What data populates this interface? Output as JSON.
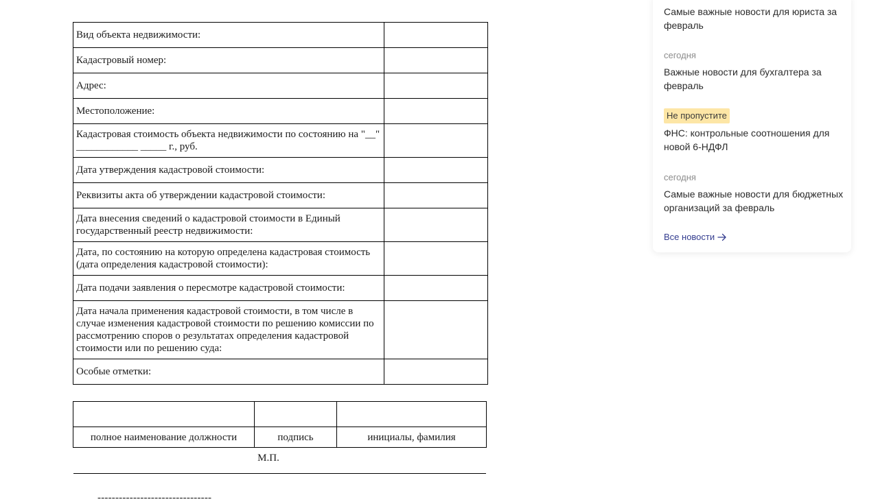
{
  "form": {
    "rows": [
      {
        "label": "Вид объекта недвижимости:"
      },
      {
        "label": "Кадастровый номер:"
      },
      {
        "label": "Адрес:"
      },
      {
        "label": "Местоположение:"
      },
      {
        "label": "Кадастровая стоимость объекта недвижимости по состоянию на \"__\" ____________ _____ г., руб."
      },
      {
        "label": "Дата утверждения кадастровой стоимости:"
      },
      {
        "label": "Реквизиты акта об утверждении кадастровой стоимости:"
      },
      {
        "label": "Дата внесения сведений о кадастровой стоимости в Единый государственный реестр недвижимости:"
      },
      {
        "label": "Дата, по состоянию на которую определена кадастровая стоимость (дата определения кадастровой стоимости):"
      },
      {
        "label": "Дата подачи заявления о пересмотре кадастровой стоимости:"
      },
      {
        "label": "Дата начала применения кадастровой стоимости, в том числе в случае изменения кадастровой стоимости по решению комиссии по рассмотрению споров о результатах определения кадастровой стоимости или по решению суда:"
      },
      {
        "label": "Особые отметки:"
      }
    ]
  },
  "signature": {
    "position_label": "полное наименование должности",
    "sign_label": "подпись",
    "name_label": "инициалы, фамилия",
    "stamp": "М.П."
  },
  "footnote_separator": "--------------------------------",
  "news": {
    "items": [
      {
        "date": "",
        "badge": "",
        "title": "Самые важные новости для юриста за февраль"
      },
      {
        "date": "сегодня",
        "badge": "",
        "title": "Важные новости для бухгалтера за февраль"
      },
      {
        "date": "",
        "badge": "Не пропустите",
        "title": "ФНС: контрольные соотношения для новой 6-НДФЛ"
      },
      {
        "date": "сегодня",
        "badge": "",
        "title": "Самые важные новости для бюджетных организаций за февраль"
      }
    ],
    "all_news_label": "Все новости"
  }
}
